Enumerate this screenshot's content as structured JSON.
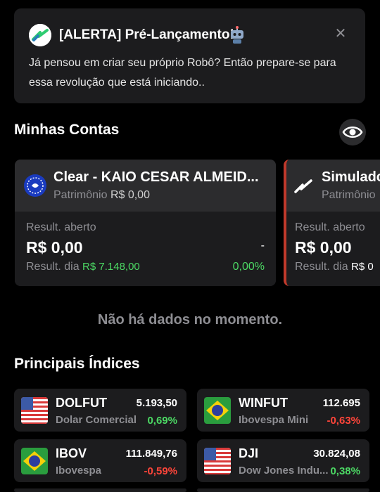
{
  "alert": {
    "title": "[ALERTA] Pré-Lançamento!",
    "line1": "Já pensou em criar seu próprio Robô? Então prepare-se para",
    "line2": "essa revolução que está iniciando..",
    "close": "✕"
  },
  "accounts_section": {
    "title": "Minhas Contas"
  },
  "accounts": [
    {
      "name": "Clear - KAIO CESAR ALMEID...",
      "patrimonio_label": "Patrimônio",
      "patrimonio_value": "R$ 0,00",
      "result_aberto_label": "Result. aberto",
      "result_aberto_value": "R$ 0,00",
      "result_aberto_extra": "-",
      "result_dia_label": "Result. dia",
      "result_dia_value": "R$ 7.148,00",
      "result_dia_pct": "0,00%"
    },
    {
      "name": "Simulado",
      "patrimonio_label": "Patrimônio",
      "result_aberto_label": "Result. aberto",
      "result_aberto_value": "R$ 0,00",
      "result_dia_label": "Result. dia",
      "result_dia_value": "R$ 0"
    }
  ],
  "empty_message": "Não há dados no momento.",
  "indices_section": {
    "title": "Principais Índices"
  },
  "indices": [
    {
      "symbol": "DOLFUT",
      "price": "5.193,50",
      "name": "Dolar Comercial",
      "change": "0,69%",
      "flag": "usa-flag",
      "direction": "up"
    },
    {
      "symbol": "WINFUT",
      "price": "112.695",
      "name": "Ibovespa Mini",
      "change": "-0,63%",
      "flag": "brazil-flag",
      "direction": "down"
    },
    {
      "symbol": "IBOV",
      "price": "111.849,76",
      "name": "Ibovespa",
      "change": "-0,59%",
      "flag": "brazil-flag",
      "direction": "down"
    },
    {
      "symbol": "DJI",
      "price": "30.824,08",
      "name": "Dow Jones Indu...",
      "change": "0,38%",
      "flag": "usa-flag",
      "direction": "up"
    }
  ],
  "colors": {
    "background": "#000000",
    "card": "#1c1c1e",
    "positive": "#4cd964",
    "negative": "#ff453a",
    "muted": "#8e8e93",
    "simulado_accent": "#c0392b"
  }
}
